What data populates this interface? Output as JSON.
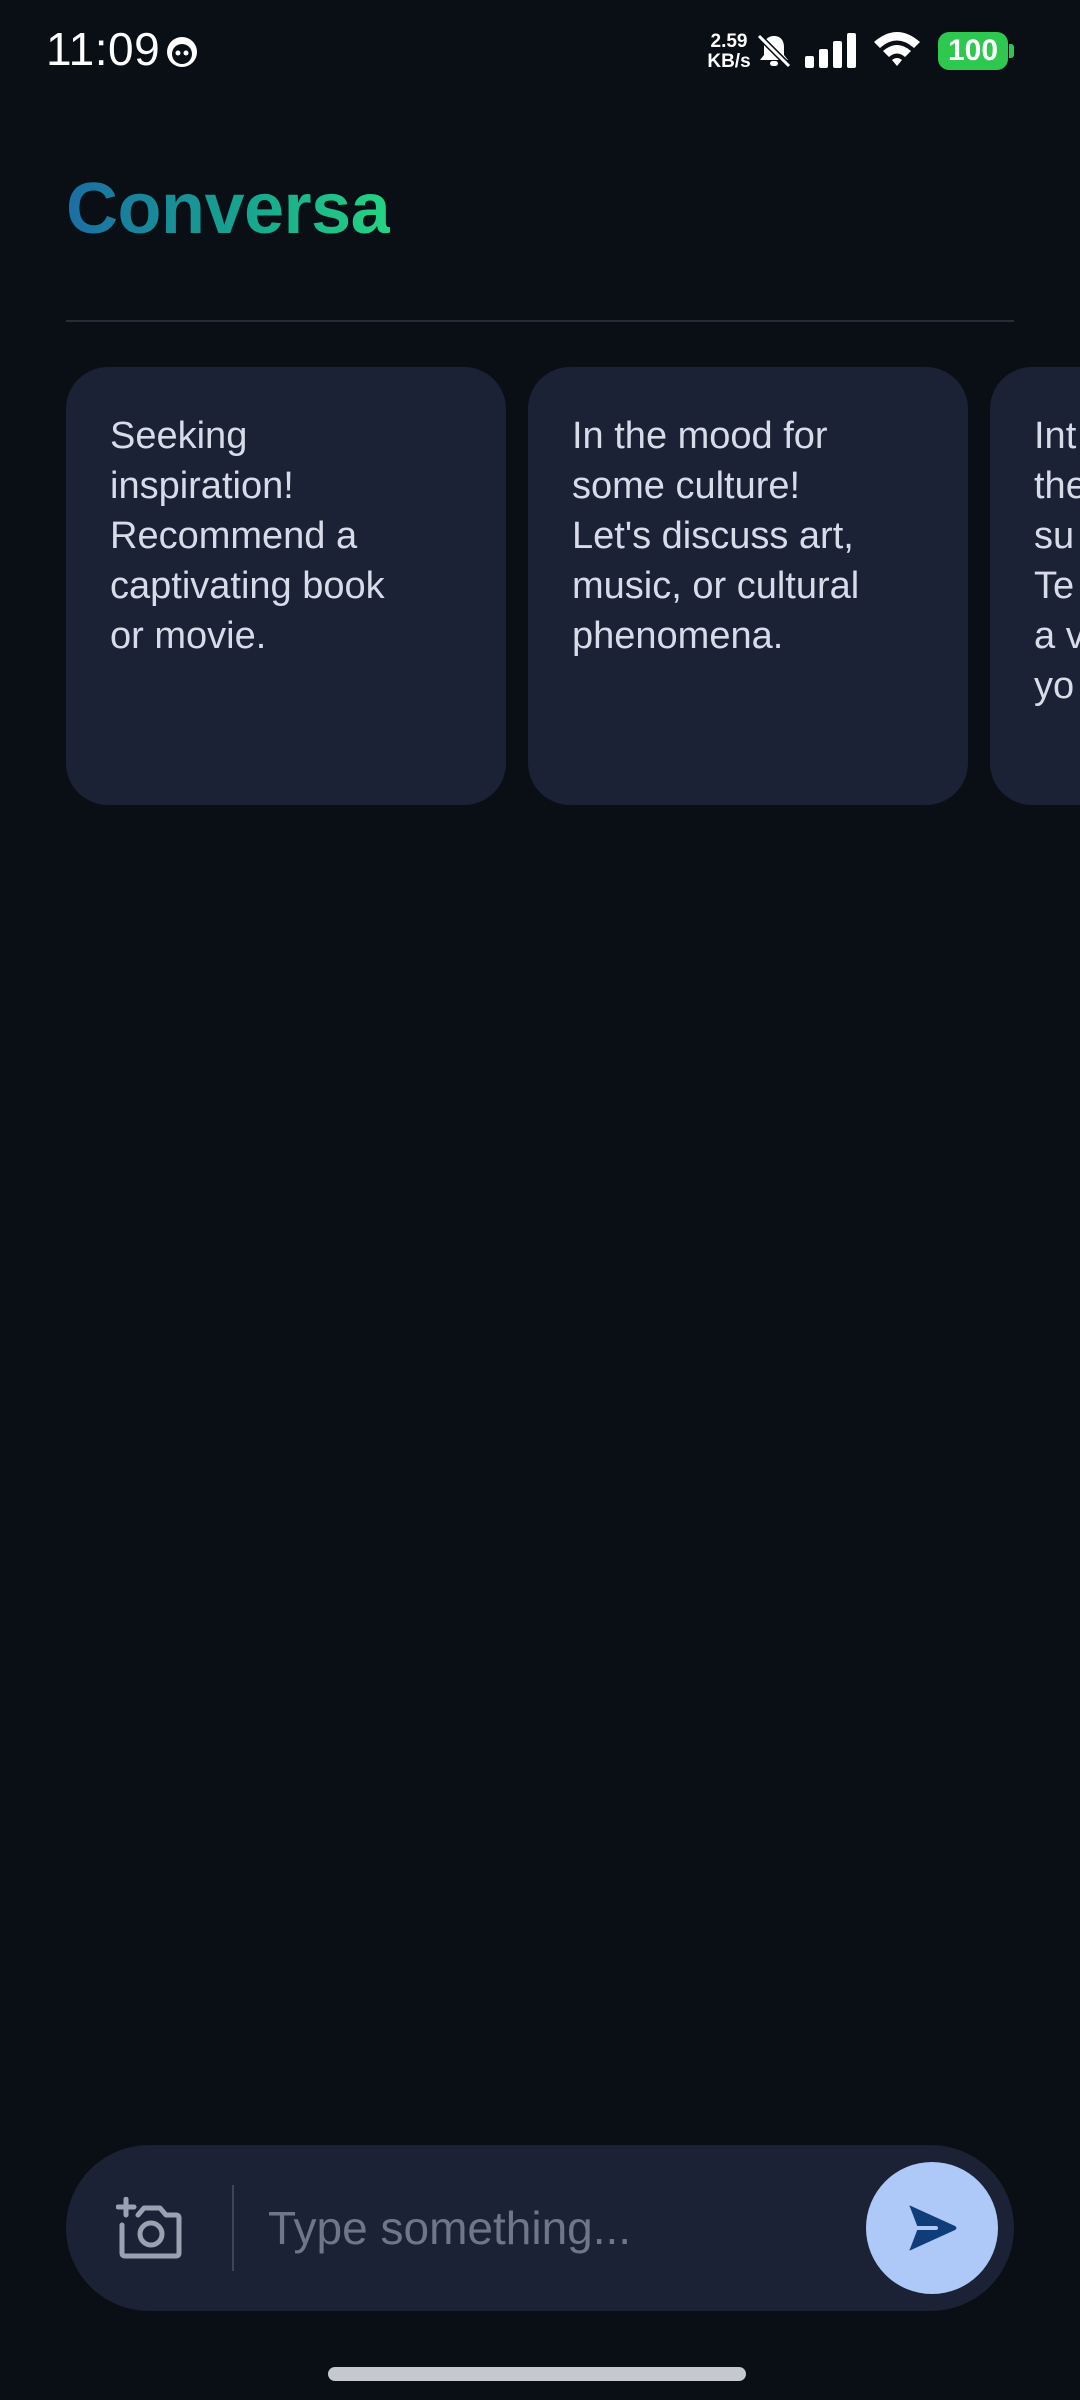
{
  "status_bar": {
    "time": "11:09",
    "net_speed_value": "2.59",
    "net_speed_unit": "KB/s",
    "battery": "100",
    "battery_color": "#2ec750",
    "icons": [
      "notification-app-icon",
      "bell-muted-icon",
      "cellular-signal-icon",
      "wifi-icon"
    ]
  },
  "header": {
    "title": "Conversa",
    "title_gradient": [
      "#1b6ea4",
      "#16a58e",
      "#25d483"
    ]
  },
  "suggestions": [
    {
      "text": "Seeking inspiration! Recommend a captivating book or movie."
    },
    {
      "text": "In the mood for some culture! Let's discuss art, music, or cultural phenomena."
    },
    {
      "text": "Int the su Te a v yo"
    }
  ],
  "composer": {
    "placeholder": "Type something...",
    "value": "",
    "camera_icon": "add-photo-camera-icon",
    "send_icon": "send-icon",
    "send_color": "#aec8f7"
  },
  "colors": {
    "background": "#0a0e15",
    "surface": "#1b2236",
    "text": "#d7dce8"
  }
}
